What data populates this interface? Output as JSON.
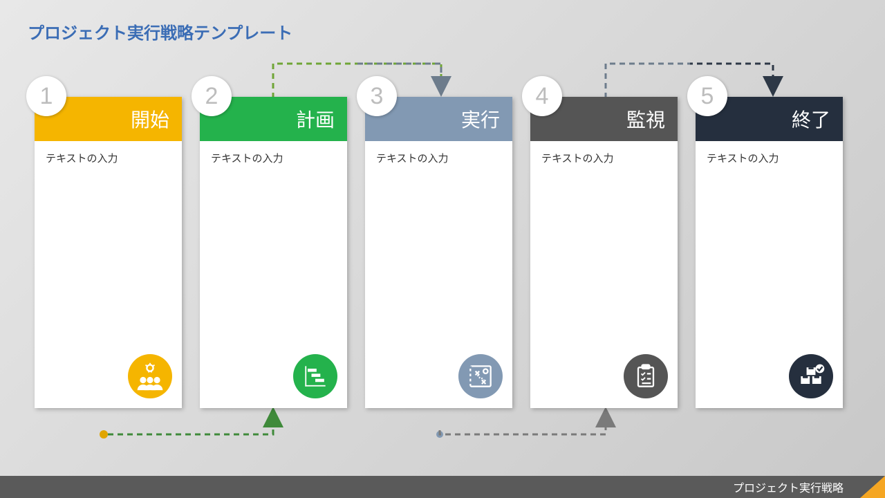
{
  "title": "プロジェクト実行戦略テンプレート",
  "footer": "プロジェクト実行戦略",
  "cards": [
    {
      "num": "1",
      "label": "開始",
      "body": "テキストの入力",
      "color": "#f5b500",
      "icon": "team-idea"
    },
    {
      "num": "2",
      "label": "計画",
      "body": "テキストの入力",
      "color": "#24b24c",
      "icon": "gantt"
    },
    {
      "num": "3",
      "label": "実行",
      "body": "テキストの入力",
      "color": "#8299b3",
      "icon": "tactics"
    },
    {
      "num": "4",
      "label": "監視",
      "body": "テキストの入力",
      "color": "#555555",
      "icon": "clipboard"
    },
    {
      "num": "5",
      "label": "終了",
      "body": "テキストの入力",
      "color": "#252f3e",
      "icon": "boxes-check"
    }
  ],
  "connectors": {
    "top_left_color": "#6fa536",
    "top_right_color": "#6d7c8c",
    "far_right_color": "#2d3846",
    "bottom_left_color": "#3f8a3a",
    "bottom_left_start": "#e0a500",
    "bottom_right_color": "#7a7a7a"
  }
}
